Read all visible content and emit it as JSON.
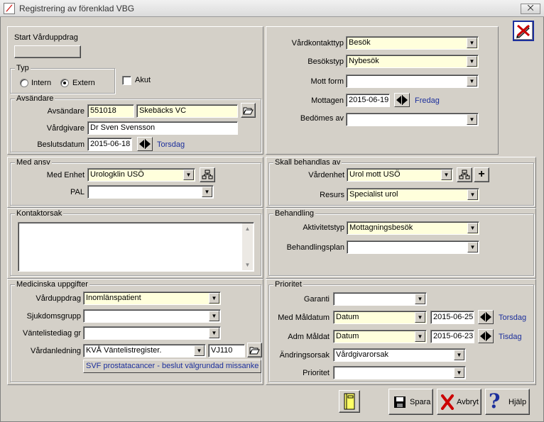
{
  "window": {
    "title": "Registrering av förenklad VBG",
    "close_label": "⨉"
  },
  "start": {
    "label": "Start Vårduppdrag",
    "button_value": ""
  },
  "typ": {
    "legend": "Typ",
    "intern": "Intern",
    "extern": "Extern",
    "akut": "Akut",
    "selected": "Extern"
  },
  "avsandare": {
    "legend": "Avsändare",
    "avsandare_label": "Avsändare",
    "avsandare_code": "551018",
    "avsandare_name": "Skebäcks VC",
    "vardgivare_label": "Vårdgivare",
    "vardgivare_value": "Dr Sven Svensson",
    "beslutsdatum_label": "Beslutsdatum",
    "beslutsdatum_value": "2015-06-18",
    "beslutsdatum_day": "Torsdag"
  },
  "vardkontakt": {
    "vardkontakttyp_label": "Vårdkontakttyp",
    "vardkontakttyp_value": "Besök",
    "besokstyp_label": "Besökstyp",
    "besokstyp_value": "Nybesök",
    "mott_form_label": "Mott form",
    "mott_form_value": "",
    "mottagen_label": "Mottagen",
    "mottagen_value": "2015-06-19",
    "mottagen_day": "Fredag",
    "bedomes_label": "Bedömes av",
    "bedomes_value": ""
  },
  "med_ansv": {
    "legend": "Med ansv",
    "enhet_label": "Med Enhet",
    "enhet_value": "Urologklin USÖ",
    "pal_label": "PAL",
    "pal_value": ""
  },
  "skall_behandlas": {
    "legend": "Skall behandlas av",
    "vardenhet_label": "Vårdenhet",
    "vardenhet_value": "Urol mott USÖ",
    "resurs_label": "Resurs",
    "resurs_value": "Specialist urol"
  },
  "kontaktorsak": {
    "legend": "Kontaktorsak",
    "value": ""
  },
  "behandling": {
    "legend": "Behandling",
    "aktivitetstyp_label": "Aktivitetstyp",
    "aktivitetstyp_value": "Mottagningsbesök",
    "behandlingsplan_label": "Behandlingsplan",
    "behandlingsplan_value": ""
  },
  "medicinska": {
    "legend": "Medicinska uppgifter",
    "varduppdrag_label": "Vårduppdrag",
    "varduppdrag_value": "Inomlänspatient",
    "sjukdomsgrupp_label": "Sjukdomsgrupp",
    "sjukdomsgrupp_value": "",
    "vantelistediag_label": "Väntelistediag gr",
    "vantelistediag_value": "",
    "vardanledning_label": "Vårdanledning",
    "vardanledning_value": "KVÅ Väntelistregister.",
    "vardanledning_code": "VJ110",
    "diagnosis_link": "SVF prostatacancer - beslut välgrundad missanke om"
  },
  "prioritet": {
    "legend": "Prioritet",
    "garanti_label": "Garanti",
    "garanti_value": "",
    "med_maldatum_label": "Med Måldatum",
    "med_maldatum_type": "Datum",
    "med_maldatum_value": "2015-06-25",
    "med_maldatum_day": "Torsdag",
    "adm_maldat_label": "Adm Måldat",
    "adm_maldat_type": "Datum",
    "adm_maldat_value": "2015-06-23",
    "adm_maldat_day": "Tisdag",
    "andringsorsak_label": "Ändringsorsak",
    "andringsorsak_value": "Vårdgivarorsak",
    "prioritet_label": "Prioritet",
    "prioritet_value": ""
  },
  "footer": {
    "spara": "Spara",
    "avbryt": "Avbryt",
    "hjalp": "Hjälp"
  },
  "icons": {
    "dropdown_arrow": "▼",
    "scroll_up": "▲",
    "scroll_down": "▼",
    "add": "+",
    "help_glyph": "?"
  },
  "colors": {
    "required_bg": "#ffffdc",
    "link_blue": "#1c2f9c",
    "window_bg": "#d4d0c8"
  }
}
